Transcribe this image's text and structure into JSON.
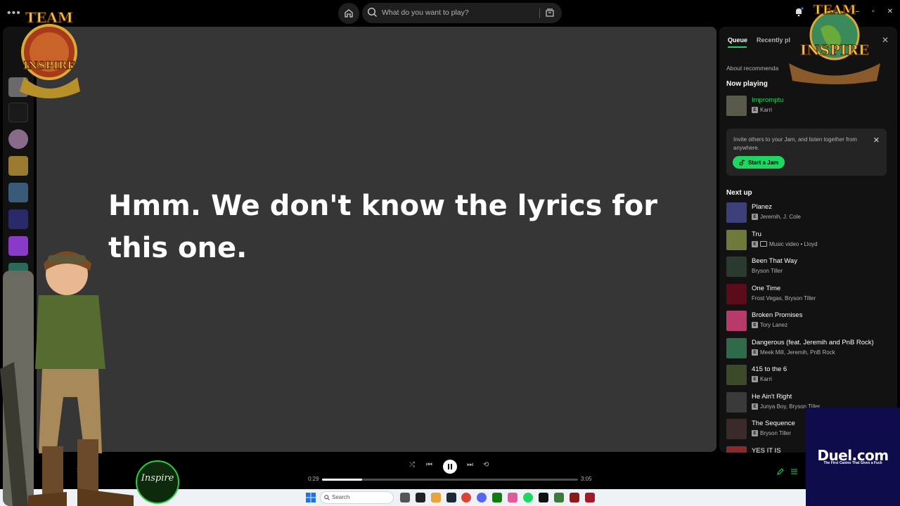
{
  "search": {
    "placeholder": "What do you want to play?"
  },
  "main": {
    "lyrics_message": "Hmm. We don't know the lyrics for this one."
  },
  "queue_panel": {
    "tabs": [
      {
        "label": "Queue",
        "active": true
      },
      {
        "label": "Recently pl"
      }
    ],
    "about_recommendations": "About recommenda",
    "now_playing_heading": "Now playing",
    "now_playing": {
      "title": "Impromptu",
      "artist": "Karri",
      "explicit": true
    },
    "jam": {
      "text": "Invite others to your Jam, and listen together from anywhere.",
      "button_label": "Start a Jam"
    },
    "next_up_heading": "Next up",
    "next_up": [
      {
        "title": "Planez",
        "subtitle": "Jeremih, J. Cole",
        "explicit": true,
        "color": "#3b3f7a"
      },
      {
        "title": "Tru",
        "subtitle": "Music video • Lloyd",
        "explicit": true,
        "music_video": true,
        "color": "#6d7a3a"
      },
      {
        "title": "Been That Way",
        "subtitle": "Bryson Tiller",
        "explicit": false,
        "color": "#2a3a2e"
      },
      {
        "title": "One Time",
        "subtitle": "Frost Vegas, Bryson Tiller",
        "explicit": false,
        "color": "#5a0c1a"
      },
      {
        "title": "Broken Promises",
        "subtitle": "Tory Lanez",
        "explicit": true,
        "color": "#b83a6a"
      },
      {
        "title": "Dangerous (feat. Jeremih and PnB Rock)",
        "subtitle": "Meek Mill, Jeremih, PnB Rock",
        "explicit": true,
        "color": "#2f6a4a"
      },
      {
        "title": "415 to the 6",
        "subtitle": "Karri",
        "explicit": true,
        "color": "#3d4a2a"
      },
      {
        "title": "He Ain't Right",
        "subtitle": "Junya Boy, Bryson Tiller",
        "explicit": true,
        "color": "#3a3a3a"
      },
      {
        "title": "The Sequence",
        "subtitle": "Bryson Tiller",
        "explicit": true,
        "color": "#3a2a2a"
      },
      {
        "title": "YES IT IS",
        "subtitle": "",
        "explicit": false,
        "color": "#8a2a2a"
      }
    ]
  },
  "player": {
    "elapsed": "0:29",
    "duration": "3:05",
    "progress": 0.157
  },
  "taskbar": {
    "search_placeholder": "Search"
  },
  "overlays": {
    "team_inspire_top_line": "TEAM",
    "team_inspire_bottom_line": "INSPIRE",
    "live_badge_text": "Inspire",
    "duel_title": "Duel.com",
    "duel_tagline": "The First Casino That Gives a Fuck"
  },
  "colors": {
    "accent": "#1ed760",
    "main_bg": "#363636",
    "panel_bg": "#121212"
  }
}
